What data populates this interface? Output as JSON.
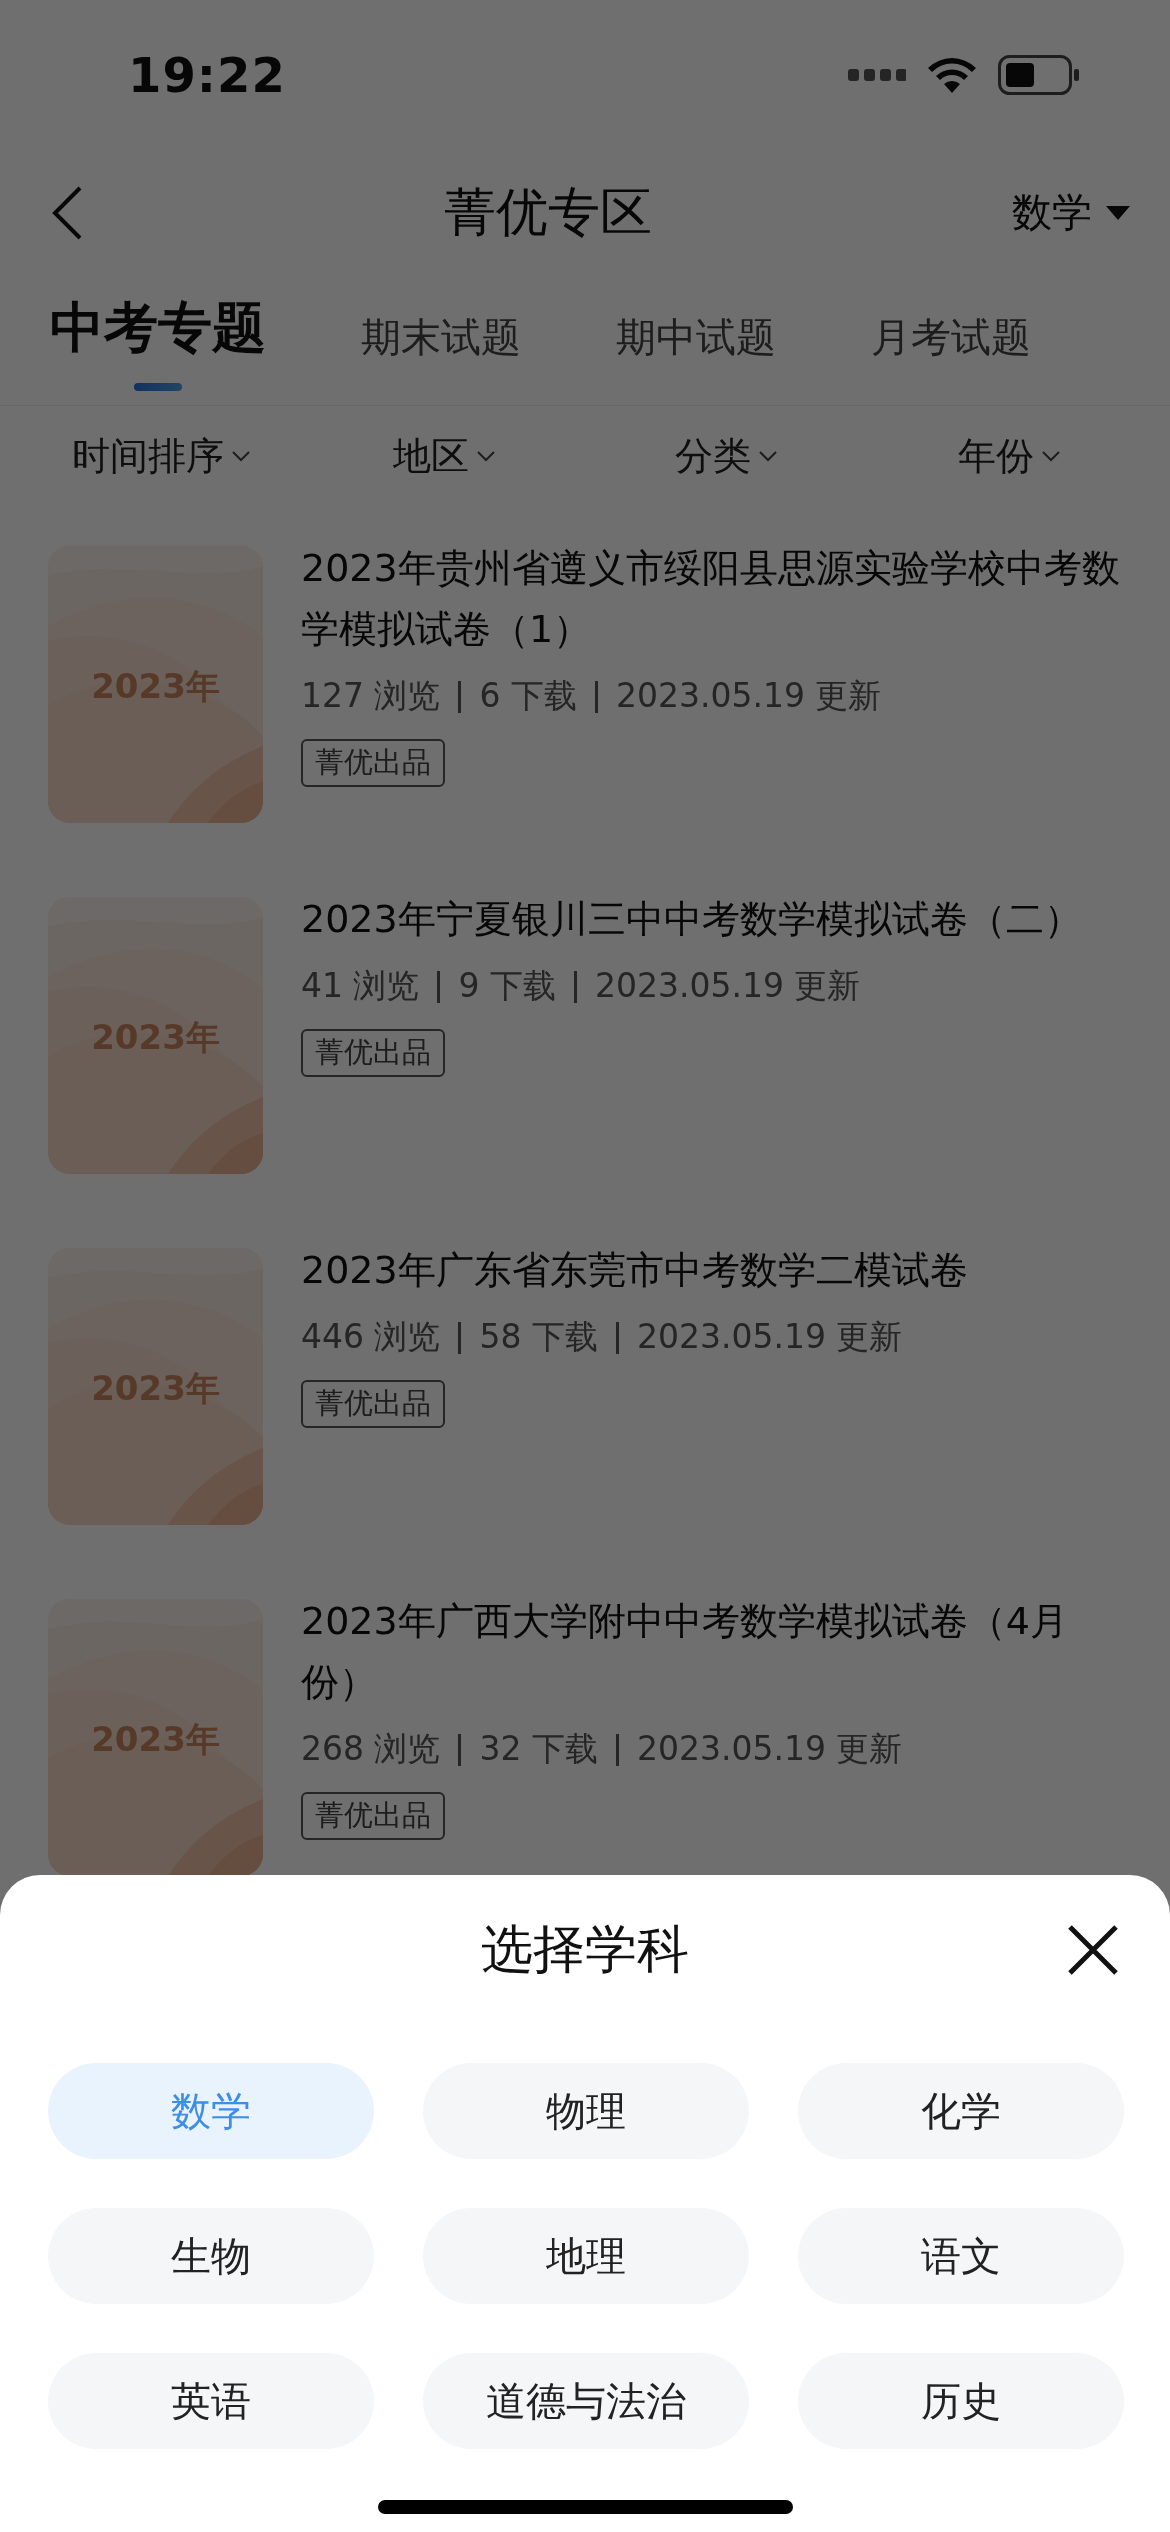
{
  "status_bar": {
    "time": "19:22"
  },
  "nav": {
    "title": "菁优专区",
    "subject": "数学"
  },
  "tabs": [
    {
      "label": "中考专题",
      "selected": true
    },
    {
      "label": "期末试题",
      "selected": false
    },
    {
      "label": "期中试题",
      "selected": false
    },
    {
      "label": "月考试题",
      "selected": false
    }
  ],
  "filters": [
    "时间排序",
    "地区",
    "分类",
    "年份"
  ],
  "papers": [
    {
      "cover": "2023年",
      "title": "2023年贵州省遵义市绥阳县思源实验学校中考数学模拟试卷（1）",
      "views": "127 浏览",
      "downloads": "6 下载",
      "updated": "2023.05.19 更新",
      "badge": "菁优出品"
    },
    {
      "cover": "2023年",
      "title": "2023年宁夏银川三中中考数学模拟试卷（二）",
      "views": "41 浏览",
      "downloads": "9 下载",
      "updated": "2023.05.19 更新",
      "badge": "菁优出品"
    },
    {
      "cover": "2023年",
      "title": "2023年广东省东莞市中考数学二模试卷",
      "views": "446 浏览",
      "downloads": "58 下载",
      "updated": "2023.05.19 更新",
      "badge": "菁优出品"
    },
    {
      "cover": "2023年",
      "title": "2023年广西大学附中中考数学模拟试卷（4月份）",
      "views": "268 浏览",
      "downloads": "32 下载",
      "updated": "2023.05.19 更新",
      "badge": "菁优出品"
    }
  ],
  "sheet": {
    "title": "选择学科",
    "subjects": [
      {
        "label": "数学",
        "selected": true
      },
      {
        "label": "物理",
        "selected": false
      },
      {
        "label": "化学",
        "selected": false
      },
      {
        "label": "生物",
        "selected": false
      },
      {
        "label": "地理",
        "selected": false
      },
      {
        "label": "语文",
        "selected": false
      },
      {
        "label": "英语",
        "selected": false
      },
      {
        "label": "道德与法治",
        "selected": false
      },
      {
        "label": "历史",
        "selected": false
      }
    ]
  }
}
